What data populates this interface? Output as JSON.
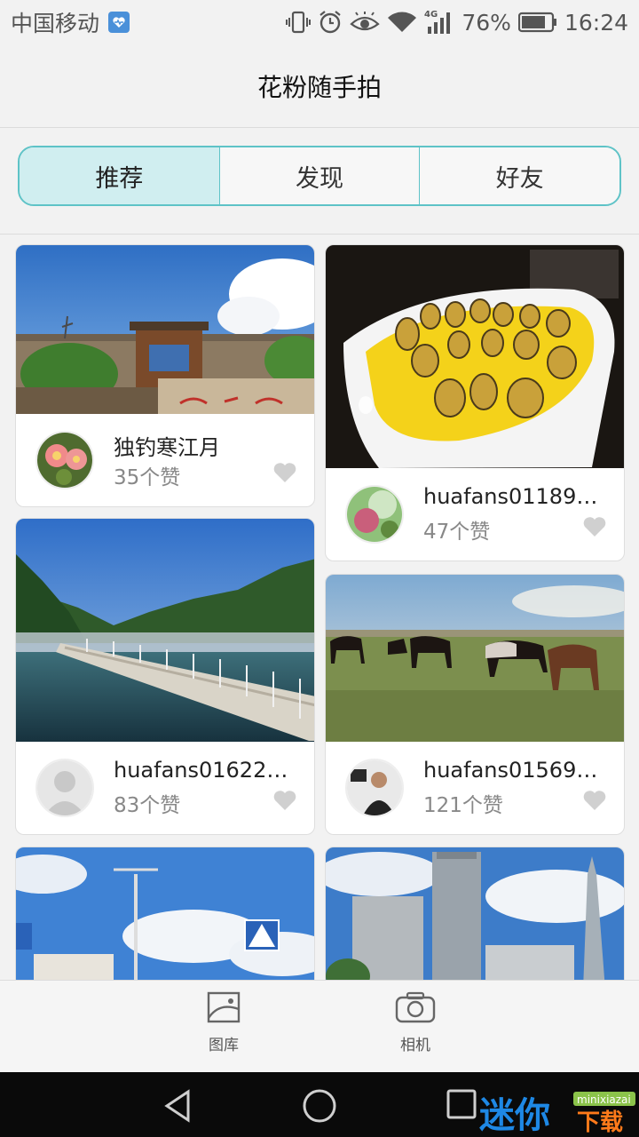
{
  "status": {
    "carrier": "中国移动",
    "battery": "76%",
    "time": "16:24",
    "network": "4G"
  },
  "header": {
    "title": "花粉随手拍"
  },
  "tabs": [
    {
      "label": "推荐",
      "active": true
    },
    {
      "label": "发现",
      "active": false
    },
    {
      "label": "好友",
      "active": false
    }
  ],
  "feed": {
    "left": [
      {
        "author": "独钓寒江月",
        "likes": "35个赞",
        "photo": "great-wall-gate"
      },
      {
        "author": "huafans016224...",
        "likes": "83个赞",
        "photo": "lake-pier"
      },
      {
        "author": "",
        "likes": "",
        "photo": "road-sign-street"
      }
    ],
    "right": [
      {
        "author": "huafans011899...",
        "likes": "47个赞",
        "photo": "yellow-dessert-plate"
      },
      {
        "author": "huafans015698...",
        "likes": "121个赞",
        "photo": "horses-grassland"
      },
      {
        "author": "",
        "likes": "",
        "photo": "city-skyline"
      }
    ]
  },
  "bottom_nav": {
    "gallery_label": "图库",
    "camera_label": "相机"
  },
  "watermark": {
    "brand": "迷你下载",
    "site": "minixiazai"
  },
  "colors": {
    "accent": "#5ec3c7",
    "tab_active_bg": "#d0eef0",
    "like_text": "#888888"
  }
}
